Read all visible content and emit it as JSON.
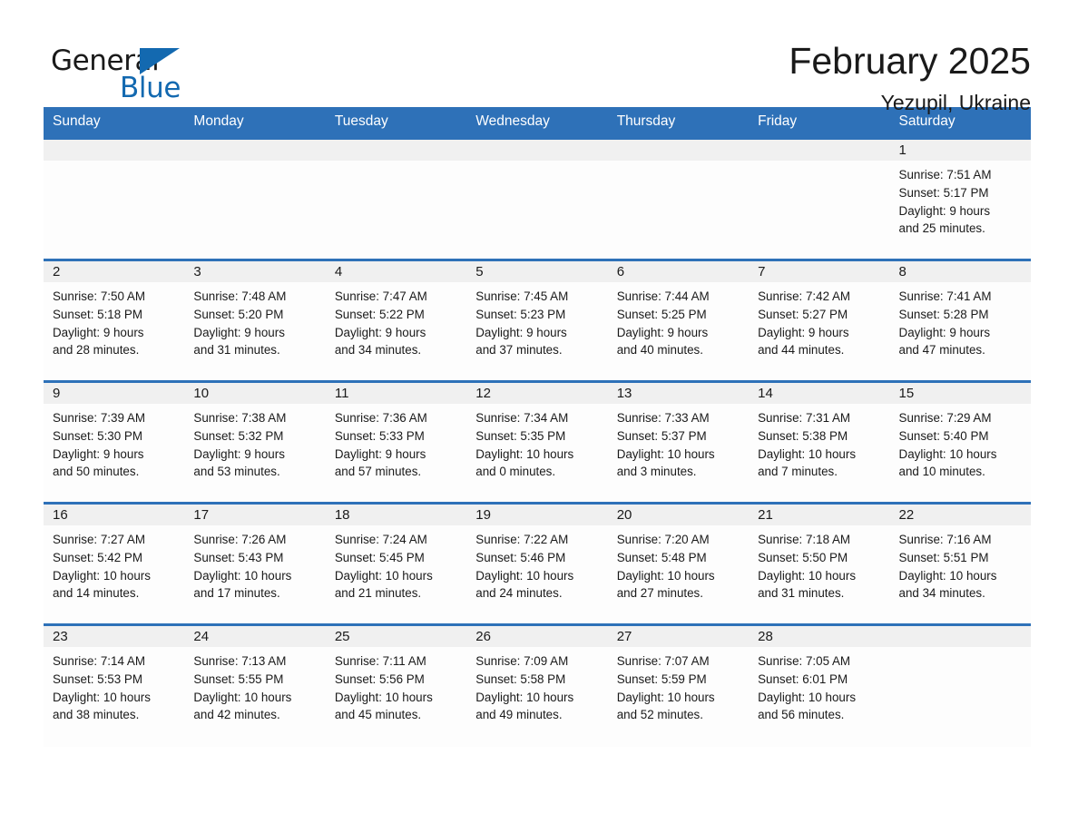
{
  "brand": {
    "name_part1": "General",
    "name_part2": "Blue",
    "accent_color": "#1369b0"
  },
  "header": {
    "title": "February 2025",
    "subtitle": "Yezupil, Ukraine"
  },
  "theme": {
    "header_blue": "#2e71b8",
    "date_band_gray": "#f0f0f0",
    "text_color": "#1a1a1a"
  },
  "weekday_headers": [
    "Sunday",
    "Monday",
    "Tuesday",
    "Wednesday",
    "Thursday",
    "Friday",
    "Saturday"
  ],
  "labels": {
    "sunrise_prefix": "Sunrise:",
    "sunset_prefix": "Sunset:",
    "daylight_prefix": "Daylight:"
  },
  "weeks": [
    [
      {
        "date": "",
        "empty": true
      },
      {
        "date": "",
        "empty": true
      },
      {
        "date": "",
        "empty": true
      },
      {
        "date": "",
        "empty": true
      },
      {
        "date": "",
        "empty": true
      },
      {
        "date": "",
        "empty": true
      },
      {
        "date": "1",
        "sunrise": "Sunrise: 7:51 AM",
        "sunset": "Sunset: 5:17 PM",
        "daylight_line1": "Daylight: 9 hours",
        "daylight_line2": "and 25 minutes."
      }
    ],
    [
      {
        "date": "2",
        "sunrise": "Sunrise: 7:50 AM",
        "sunset": "Sunset: 5:18 PM",
        "daylight_line1": "Daylight: 9 hours",
        "daylight_line2": "and 28 minutes."
      },
      {
        "date": "3",
        "sunrise": "Sunrise: 7:48 AM",
        "sunset": "Sunset: 5:20 PM",
        "daylight_line1": "Daylight: 9 hours",
        "daylight_line2": "and 31 minutes."
      },
      {
        "date": "4",
        "sunrise": "Sunrise: 7:47 AM",
        "sunset": "Sunset: 5:22 PM",
        "daylight_line1": "Daylight: 9 hours",
        "daylight_line2": "and 34 minutes."
      },
      {
        "date": "5",
        "sunrise": "Sunrise: 7:45 AM",
        "sunset": "Sunset: 5:23 PM",
        "daylight_line1": "Daylight: 9 hours",
        "daylight_line2": "and 37 minutes."
      },
      {
        "date": "6",
        "sunrise": "Sunrise: 7:44 AM",
        "sunset": "Sunset: 5:25 PM",
        "daylight_line1": "Daylight: 9 hours",
        "daylight_line2": "and 40 minutes."
      },
      {
        "date": "7",
        "sunrise": "Sunrise: 7:42 AM",
        "sunset": "Sunset: 5:27 PM",
        "daylight_line1": "Daylight: 9 hours",
        "daylight_line2": "and 44 minutes."
      },
      {
        "date": "8",
        "sunrise": "Sunrise: 7:41 AM",
        "sunset": "Sunset: 5:28 PM",
        "daylight_line1": "Daylight: 9 hours",
        "daylight_line2": "and 47 minutes."
      }
    ],
    [
      {
        "date": "9",
        "sunrise": "Sunrise: 7:39 AM",
        "sunset": "Sunset: 5:30 PM",
        "daylight_line1": "Daylight: 9 hours",
        "daylight_line2": "and 50 minutes."
      },
      {
        "date": "10",
        "sunrise": "Sunrise: 7:38 AM",
        "sunset": "Sunset: 5:32 PM",
        "daylight_line1": "Daylight: 9 hours",
        "daylight_line2": "and 53 minutes."
      },
      {
        "date": "11",
        "sunrise": "Sunrise: 7:36 AM",
        "sunset": "Sunset: 5:33 PM",
        "daylight_line1": "Daylight: 9 hours",
        "daylight_line2": "and 57 minutes."
      },
      {
        "date": "12",
        "sunrise": "Sunrise: 7:34 AM",
        "sunset": "Sunset: 5:35 PM",
        "daylight_line1": "Daylight: 10 hours",
        "daylight_line2": "and 0 minutes."
      },
      {
        "date": "13",
        "sunrise": "Sunrise: 7:33 AM",
        "sunset": "Sunset: 5:37 PM",
        "daylight_line1": "Daylight: 10 hours",
        "daylight_line2": "and 3 minutes."
      },
      {
        "date": "14",
        "sunrise": "Sunrise: 7:31 AM",
        "sunset": "Sunset: 5:38 PM",
        "daylight_line1": "Daylight: 10 hours",
        "daylight_line2": "and 7 minutes."
      },
      {
        "date": "15",
        "sunrise": "Sunrise: 7:29 AM",
        "sunset": "Sunset: 5:40 PM",
        "daylight_line1": "Daylight: 10 hours",
        "daylight_line2": "and 10 minutes."
      }
    ],
    [
      {
        "date": "16",
        "sunrise": "Sunrise: 7:27 AM",
        "sunset": "Sunset: 5:42 PM",
        "daylight_line1": "Daylight: 10 hours",
        "daylight_line2": "and 14 minutes."
      },
      {
        "date": "17",
        "sunrise": "Sunrise: 7:26 AM",
        "sunset": "Sunset: 5:43 PM",
        "daylight_line1": "Daylight: 10 hours",
        "daylight_line2": "and 17 minutes."
      },
      {
        "date": "18",
        "sunrise": "Sunrise: 7:24 AM",
        "sunset": "Sunset: 5:45 PM",
        "daylight_line1": "Daylight: 10 hours",
        "daylight_line2": "and 21 minutes."
      },
      {
        "date": "19",
        "sunrise": "Sunrise: 7:22 AM",
        "sunset": "Sunset: 5:46 PM",
        "daylight_line1": "Daylight: 10 hours",
        "daylight_line2": "and 24 minutes."
      },
      {
        "date": "20",
        "sunrise": "Sunrise: 7:20 AM",
        "sunset": "Sunset: 5:48 PM",
        "daylight_line1": "Daylight: 10 hours",
        "daylight_line2": "and 27 minutes."
      },
      {
        "date": "21",
        "sunrise": "Sunrise: 7:18 AM",
        "sunset": "Sunset: 5:50 PM",
        "daylight_line1": "Daylight: 10 hours",
        "daylight_line2": "and 31 minutes."
      },
      {
        "date": "22",
        "sunrise": "Sunrise: 7:16 AM",
        "sunset": "Sunset: 5:51 PM",
        "daylight_line1": "Daylight: 10 hours",
        "daylight_line2": "and 34 minutes."
      }
    ],
    [
      {
        "date": "23",
        "sunrise": "Sunrise: 7:14 AM",
        "sunset": "Sunset: 5:53 PM",
        "daylight_line1": "Daylight: 10 hours",
        "daylight_line2": "and 38 minutes."
      },
      {
        "date": "24",
        "sunrise": "Sunrise: 7:13 AM",
        "sunset": "Sunset: 5:55 PM",
        "daylight_line1": "Daylight: 10 hours",
        "daylight_line2": "and 42 minutes."
      },
      {
        "date": "25",
        "sunrise": "Sunrise: 7:11 AM",
        "sunset": "Sunset: 5:56 PM",
        "daylight_line1": "Daylight: 10 hours",
        "daylight_line2": "and 45 minutes."
      },
      {
        "date": "26",
        "sunrise": "Sunrise: 7:09 AM",
        "sunset": "Sunset: 5:58 PM",
        "daylight_line1": "Daylight: 10 hours",
        "daylight_line2": "and 49 minutes."
      },
      {
        "date": "27",
        "sunrise": "Sunrise: 7:07 AM",
        "sunset": "Sunset: 5:59 PM",
        "daylight_line1": "Daylight: 10 hours",
        "daylight_line2": "and 52 minutes."
      },
      {
        "date": "28",
        "sunrise": "Sunrise: 7:05 AM",
        "sunset": "Sunset: 6:01 PM",
        "daylight_line1": "Daylight: 10 hours",
        "daylight_line2": "and 56 minutes."
      },
      {
        "date": "",
        "empty": true
      }
    ]
  ]
}
